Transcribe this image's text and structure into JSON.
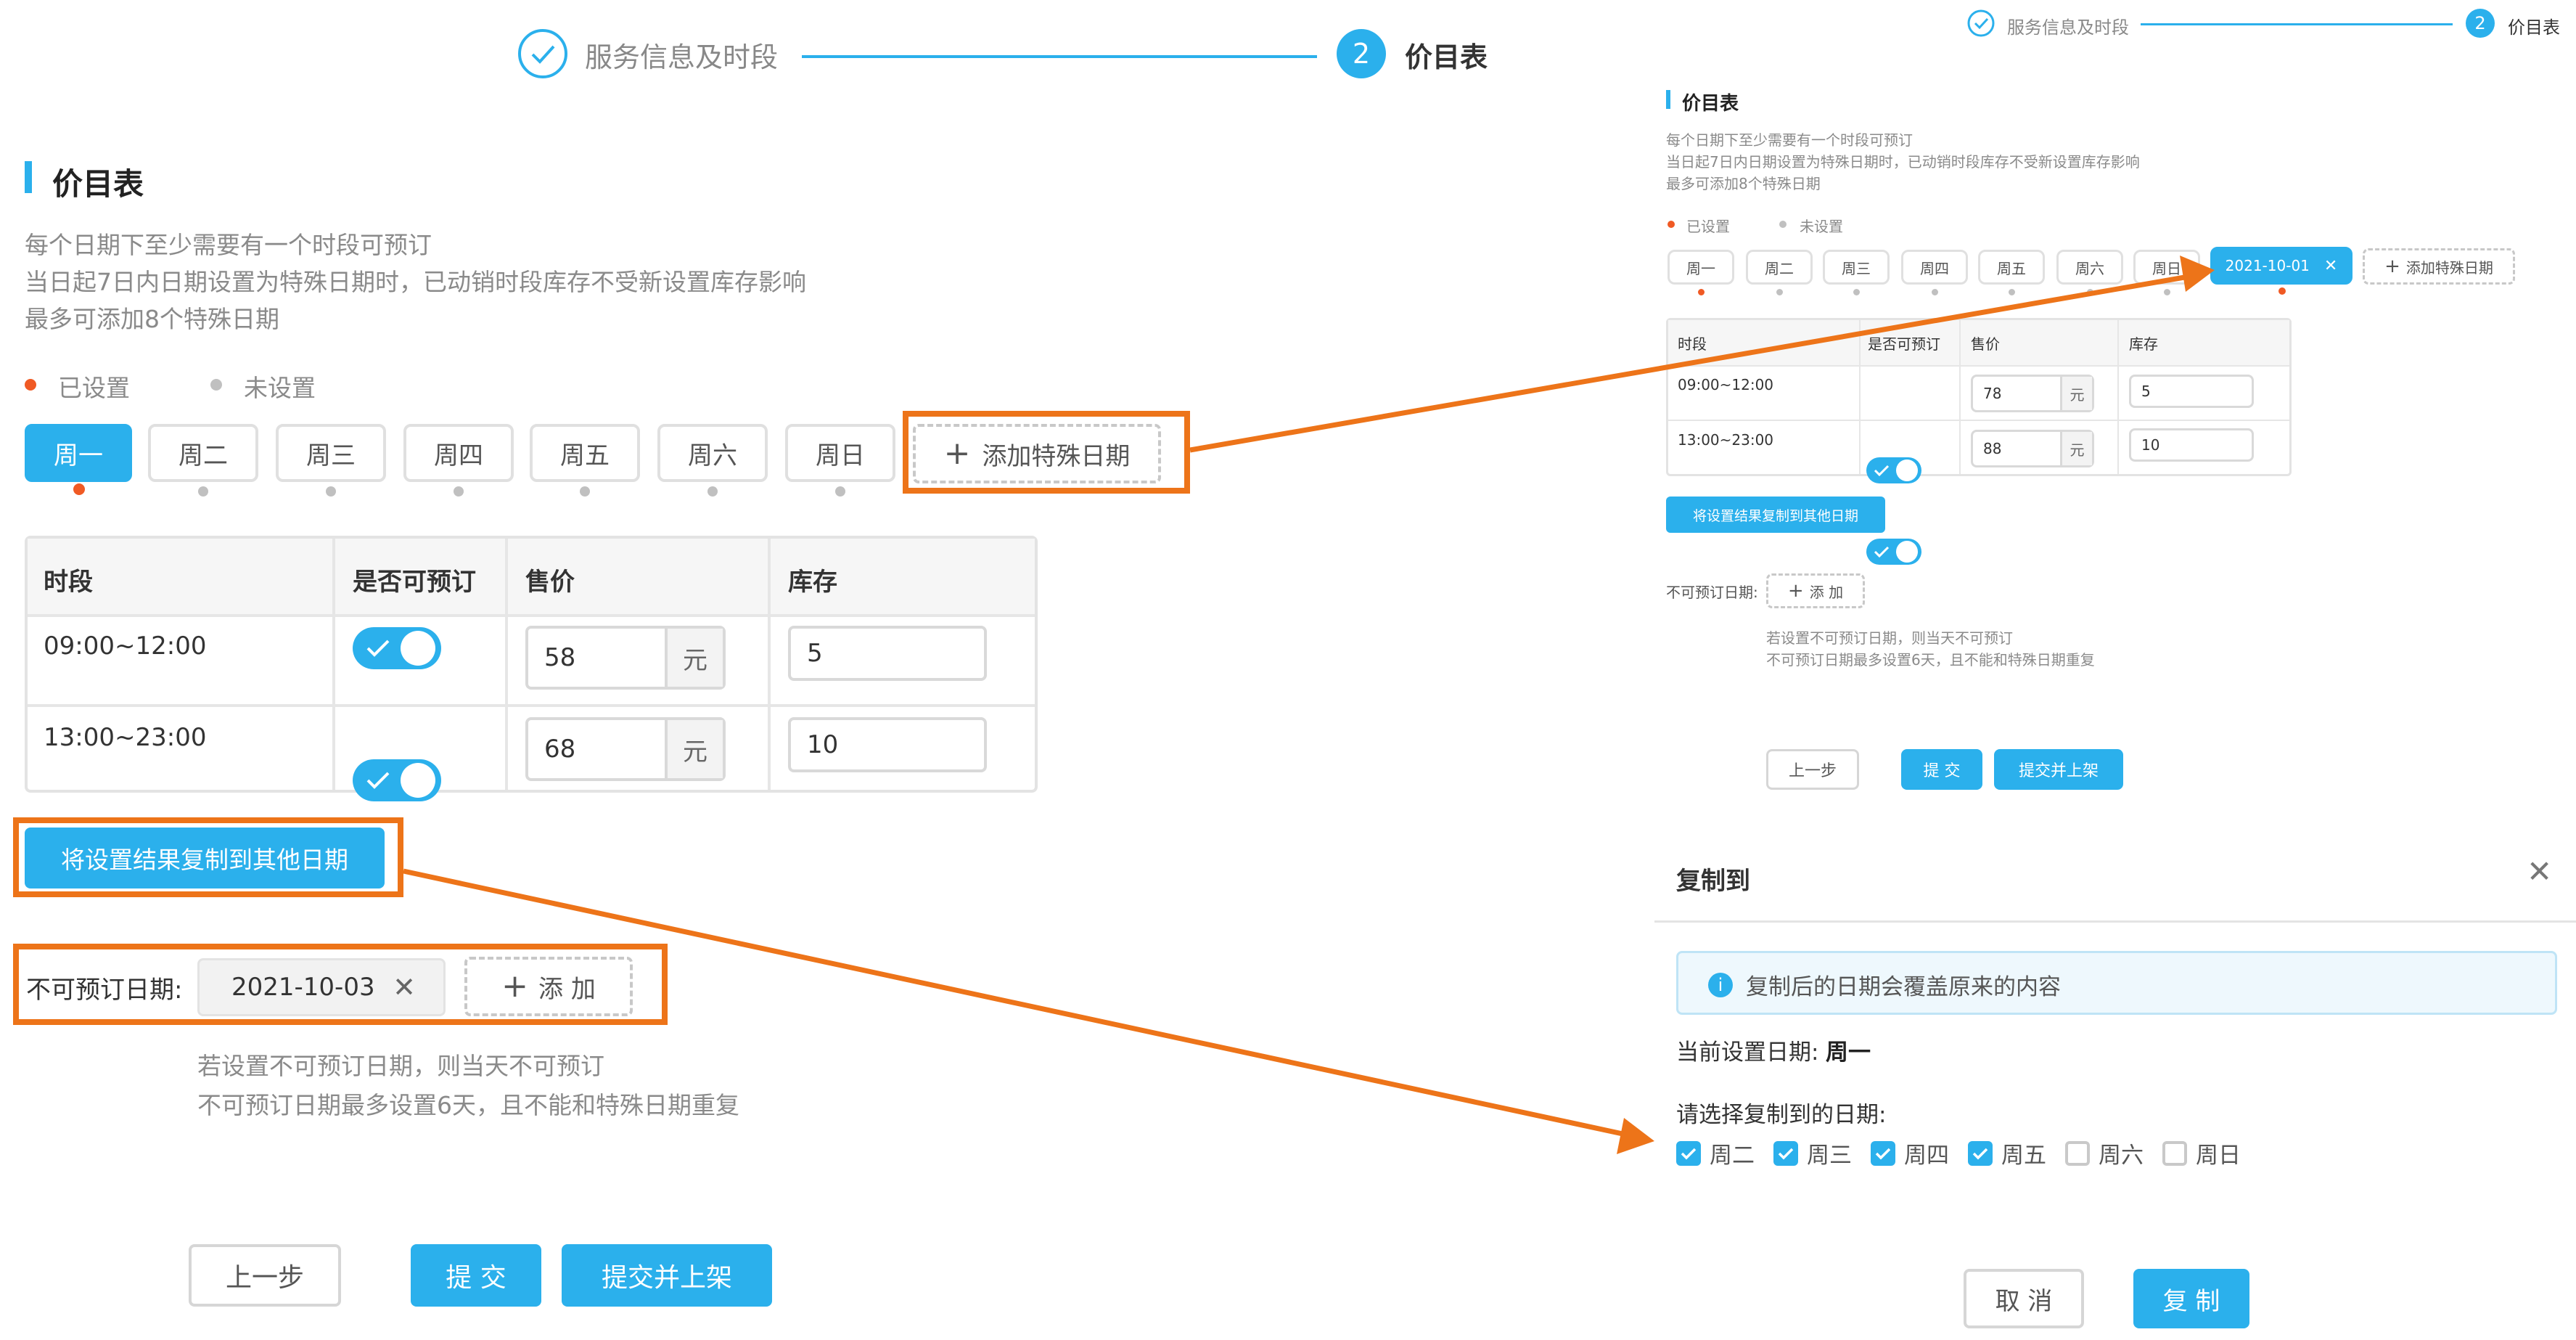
{
  "steps": {
    "step1_label": "服务信息及时段",
    "step2_number": "2",
    "step2_label": "价目表"
  },
  "section": {
    "title": "价目表",
    "notes": [
      "每个日期下至少需要有一个时段可预订",
      "当日起7日内日期设置为特殊日期时，已动销时段库存不受新设置库存影响",
      "最多可添加8个特殊日期"
    ]
  },
  "legend": {
    "set": "已设置",
    "unset": "未设置"
  },
  "tabs": [
    "周一",
    "周二",
    "周三",
    "周四",
    "周五",
    "周六",
    "周日"
  ],
  "add_special_date": "添加特殊日期",
  "table": {
    "headers": [
      "时段",
      "是否可预订",
      "售价",
      "库存"
    ],
    "unit": "元",
    "rows": [
      {
        "time": "09:00~12:00",
        "price": "58",
        "stock": "5"
      },
      {
        "time": "13:00~23:00",
        "price": "68",
        "stock": "10"
      }
    ]
  },
  "copy_button": "将设置结果复制到其他日期",
  "unavailable": {
    "label": "不可预订日期:",
    "date_tag": "2021-10-03",
    "add": "添 加",
    "notes": [
      "若设置不可预订日期，则当天不可预订",
      "不可预订日期最多设置6天，且不能和特殊日期重复"
    ]
  },
  "footer": {
    "prev": "上一步",
    "submit": "提 交",
    "submit_publish": "提交并上架"
  },
  "right_panel": {
    "special_tab": "2021-10-01",
    "tabs": [
      "周一",
      "周二",
      "周三",
      "周四",
      "周五",
      "周六",
      "周日"
    ],
    "rows": [
      {
        "time": "09:00~12:00",
        "price": "78",
        "stock": "5"
      },
      {
        "time": "13:00~23:00",
        "price": "88",
        "stock": "10"
      }
    ]
  },
  "dialog": {
    "title": "复制到",
    "info": "复制后的日期会覆盖原来的内容",
    "current_label": "当前设置日期:",
    "current_value": "周一",
    "choose_label": "请选择复制到的日期:",
    "options": [
      {
        "label": "周二",
        "checked": true
      },
      {
        "label": "周三",
        "checked": true
      },
      {
        "label": "周四",
        "checked": true
      },
      {
        "label": "周五",
        "checked": true
      },
      {
        "label": "周六",
        "checked": false
      },
      {
        "label": "周日",
        "checked": false
      }
    ],
    "cancel": "取 消",
    "confirm": "复 制"
  },
  "colors": {
    "accent": "#2bb0ec",
    "highlight": "#ed7419",
    "set_dot": "#f05a24",
    "unset_dot": "#c0c0c0"
  }
}
